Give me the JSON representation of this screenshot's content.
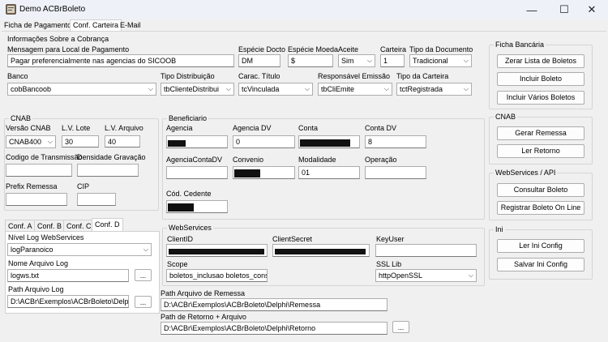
{
  "window": {
    "title": "Demo ACBrBoleto",
    "minimize": "—",
    "maximize": "☐",
    "close": "✕"
  },
  "tabs": [
    "Ficha de Pagamento",
    "Conf. Carteira",
    "E-Mail"
  ],
  "cobranca": {
    "title": "Informações Sobre a Cobrança",
    "mensagem_label": "Mensagem para Local de Pagamento",
    "mensagem_value": "Pagar preferencialmente nas agencias do SICOOB",
    "especie_docto_label": "Espécie Docto",
    "especie_docto_value": "DM",
    "especie_moeda_label": "Espécie Moeda",
    "especie_moeda_value": "$",
    "aceite_label": "Aceite",
    "aceite_value": "Sim",
    "carteira_label": "Carteira",
    "carteira_value": "1",
    "tipo_documento_label": "Tipo da Documento",
    "tipo_documento_value": "Tradicional",
    "banco_label": "Banco",
    "banco_value": "cobBancoob",
    "tipo_distribuicao_label": "Tipo Distribuição",
    "tipo_distribuicao_value": "tbClienteDistribui",
    "carac_titulo_label": "Carac. Título",
    "carac_titulo_value": "tcVinculada",
    "responsavel_emissao_label": "Responsável Emissão",
    "responsavel_emissao_value": "tbCliEmite",
    "tipo_carteira_label": "Tipo da Carteira",
    "tipo_carteira_value": "tctRegistrada"
  },
  "cnab": {
    "title": "CNAB",
    "versao_label": "Versão CNAB",
    "versao_value": "CNAB400",
    "lv_lote_label": "L.V. Lote",
    "lv_lote_value": "30",
    "lv_arquivo_label": "L.V. Arquivo",
    "lv_arquivo_value": "40",
    "codigo_transmissao_label": "Codigo de Transmissão",
    "densidade_label": "Densidade Gravação",
    "prefix_remessa_label": "Prefix Remessa",
    "cip_label": "CIP"
  },
  "conf_tabs": [
    "Conf. A",
    "Conf. B",
    "Conf. C",
    "Conf. D"
  ],
  "confd": {
    "nivel_log_label": "Nível Log WebServices",
    "nivel_log_value": "logParanoico",
    "nome_arquivo_label": "Nome Arquivo Log",
    "nome_arquivo_value": "logws.txt",
    "path_arquivo_label": "Path Arquivo Log",
    "path_arquivo_value": "D:\\ACBr\\Exemplos\\ACBrBoleto\\Delphi\\",
    "browse": "..."
  },
  "beneficiario": {
    "title": "Beneficiario",
    "agencia_label": "Agencia",
    "agencia_dv_label": "Agencia DV",
    "agencia_dv_value": "0",
    "conta_label": "Conta",
    "conta_dv_label": "Conta DV",
    "conta_dv_value": "8",
    "agencia_conta_dv_label": "AgenciaContaDV",
    "convenio_label": "Convenio",
    "modalidade_label": "Modalidade",
    "modalidade_value": "01",
    "operacao_label": "Operação",
    "cod_cedente_label": "Cód. Cedente"
  },
  "webservices": {
    "title": "WebServices",
    "client_id_label": "ClientID",
    "client_secret_label": "ClientSecret",
    "key_user_label": "KeyUser",
    "scope_label": "Scope",
    "scope_value": "boletos_inclusao boletos_consult",
    "ssl_lib_label": "SSL Lib",
    "ssl_lib_value": "httpOpenSSL"
  },
  "paths": {
    "remessa_label": "Path Arquivo de Remessa",
    "remessa_value": "D:\\ACBr\\Exemplos\\ACBrBoleto\\Delphi\\Remessa",
    "retorno_label": "Path de Retorno + Arquivo",
    "retorno_value": "D:\\ACBr\\Exemplos\\ACBrBoleto\\Delphi\\Retorno",
    "browse": "..."
  },
  "right": {
    "ficha_title": "Ficha Bancária",
    "zerar": "Zerar Lista de Boletos",
    "incluir": "Incluir Boleto",
    "incluir_varios": "Incluir Vários Boletos",
    "cnab_title": "CNAB",
    "gerar_remessa": "Gerar Remessa",
    "ler_retorno": "Ler Retorno",
    "ws_title": "WebServices / API",
    "consultar": "Consultar Boleto",
    "registrar": "Registrar Boleto On Line",
    "ini_title": "Ini",
    "ler_ini": "Ler Ini Config",
    "salvar_ini": "Salvar Ini Config"
  }
}
